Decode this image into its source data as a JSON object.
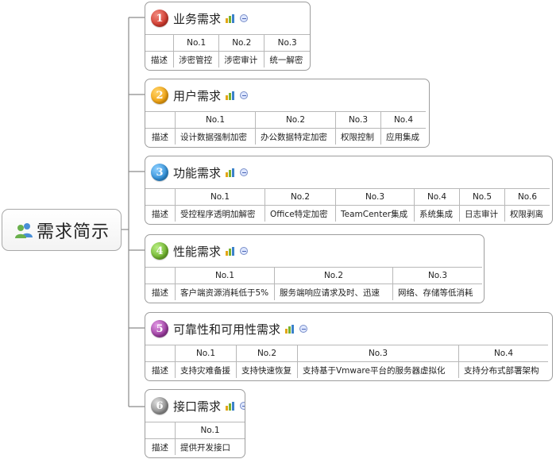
{
  "root": {
    "title": "需求简示",
    "icon": "people-icon"
  },
  "row_label": "描述",
  "branches": [
    {
      "number": "1",
      "color": "#d23a2e",
      "title": "业务需求",
      "headers": [
        "No.1",
        "No.2",
        "No.3"
      ],
      "values": [
        "涉密管控",
        "涉密审计",
        "统一解密"
      ]
    },
    {
      "number": "2",
      "color": "#f1a20f",
      "title": "用户需求",
      "headers": [
        "No.1",
        "No.2",
        "No.3",
        "No.4"
      ],
      "values": [
        "设计数据强制加密",
        "办公数据特定加密",
        "权限控制",
        "应用集成"
      ]
    },
    {
      "number": "3",
      "color": "#2f8fd8",
      "title": "功能需求",
      "headers": [
        "No.1",
        "No.2",
        "No.3",
        "No.4",
        "No.5",
        "No.6"
      ],
      "values": [
        "受控程序透明加解密",
        "Office特定加密",
        "TeamCenter集成",
        "系统集成",
        "日志审计",
        "权限剥离"
      ]
    },
    {
      "number": "4",
      "color": "#6fb22c",
      "title": "性能需求",
      "headers": [
        "No.1",
        "No.2",
        "No.3"
      ],
      "values": [
        "客户端资源消耗低于5%",
        "服务端响应请求及时、迅速",
        "网络、存储等低消耗"
      ]
    },
    {
      "number": "5",
      "color": "#9a3a9e",
      "title": "可靠性和可用性需求",
      "headers": [
        "No.1",
        "No.2",
        "No.3",
        "No.4"
      ],
      "values": [
        "支持灾难备援",
        "支持快速恢复",
        "支持基于Vmware平台的服务器虚拟化",
        "支持分布式部署架构"
      ]
    },
    {
      "number": "6",
      "color": "#8d8d8d",
      "title": "接口需求",
      "headers": [
        "No.1"
      ],
      "values": [
        "提供开发接口"
      ]
    }
  ]
}
